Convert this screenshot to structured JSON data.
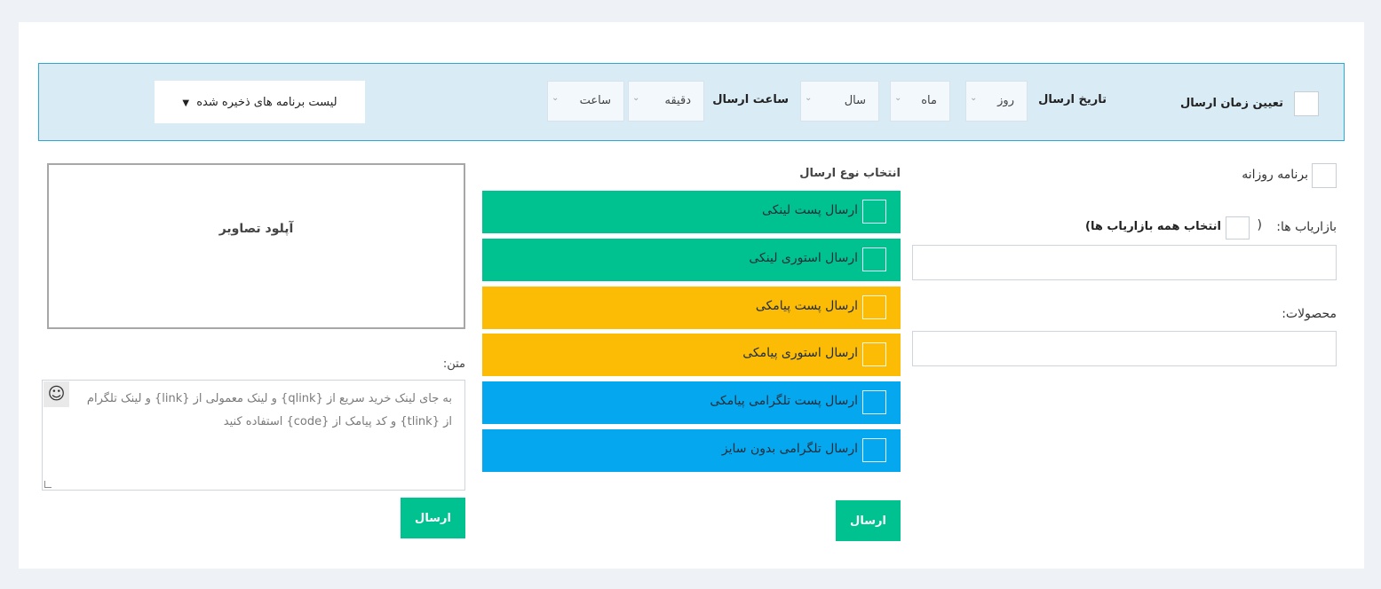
{
  "schedule": {
    "toggle_label": "تعیین زمان ارسال",
    "date_label": "تاریخ ارسال",
    "day_placeholder": "روز",
    "month_placeholder": "ماه",
    "year_placeholder": "سال",
    "time_label": "ساعت ارسال",
    "minute_placeholder": "دقیقه",
    "hour_placeholder": "ساعت",
    "saved_list_label": "لیست برنامه های ذخیره شده"
  },
  "right": {
    "daily_label": "برنامه روزانه",
    "marketers_label": "بازاریاب ها:",
    "select_all_label": "انتخاب همه بازاریاب ها)",
    "select_all_paren": "(",
    "products_label": "محصولات:"
  },
  "middle": {
    "send_type_heading": "انتخاب نوع ارسال",
    "options": [
      {
        "label": "ارسال پست لینکی"
      },
      {
        "label": "ارسال استوری لینکی"
      },
      {
        "label": "ارسال پست پیامکی"
      },
      {
        "label": "ارسال استوری پیامکی"
      },
      {
        "label": "ارسال پست تلگرامی پیامکی"
      },
      {
        "label": "ارسال تلگرامی بدون سایز"
      }
    ],
    "send_button": "ارسال"
  },
  "left": {
    "upload_label": "آپلود تصاویر",
    "text_label": "متن:",
    "text_placeholder": "به جای لینک خرید سریع از {qlink} و لینک معمولی از {link} و لینک تلگرام از {tlink} و کد پیامک از {code} استفاده کنید",
    "send_button": "ارسال"
  },
  "colors": {
    "green": "#00c290",
    "yellow": "#fcbc06",
    "blue": "#05a8ef",
    "bar_bg": "#d9ebf5",
    "bar_border": "#2aa9d6"
  },
  "icons": {
    "emoji": "smiley-icon",
    "caret": "caret-down-icon",
    "select_chevron": "chevron-down-icon"
  }
}
